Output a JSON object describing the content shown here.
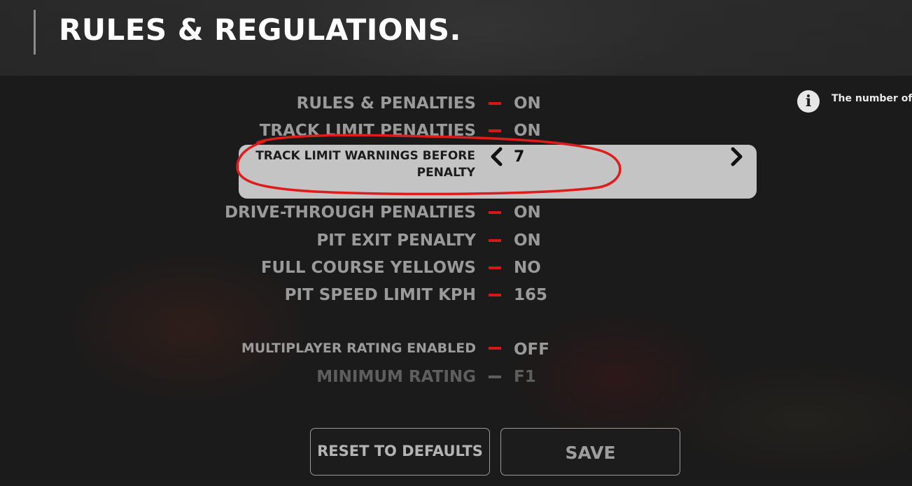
{
  "header": {
    "title": "RULES & REGULATIONS."
  },
  "settings": [
    {
      "label": "RULES & PENALTIES",
      "value": "ON"
    },
    {
      "label": "TRACK LIMIT PENALTIES",
      "value": "ON"
    },
    {
      "label": "TRACK LIMIT WARNINGS BEFORE PENALTY",
      "value": "7",
      "selected": true
    },
    {
      "label": "DRIVE-THROUGH PENALTIES",
      "value": "ON"
    },
    {
      "label": "PIT EXIT PENALTY",
      "value": "ON"
    },
    {
      "label": "FULL COURSE YELLOWS",
      "value": "NO"
    },
    {
      "label": "PIT SPEED LIMIT KPH",
      "value": "165"
    },
    {
      "label": "MULTIPLAYER RATING ENABLED",
      "value": "OFF"
    },
    {
      "label": "MINIMUM RATING",
      "value": "F1",
      "disabled": true
    }
  ],
  "info": {
    "icon": "info-icon",
    "text": "The number of will be issued drive-through"
  },
  "buttons": {
    "reset_label": "RESET TO DEFAULTS",
    "save_label": "SAVE"
  },
  "colors": {
    "accent": "#d41818",
    "annotation": "#e01b1b",
    "selected_bg": "#c4c4c4"
  },
  "icons": {
    "left": "chevron-left-icon",
    "right": "chevron-right-icon"
  }
}
